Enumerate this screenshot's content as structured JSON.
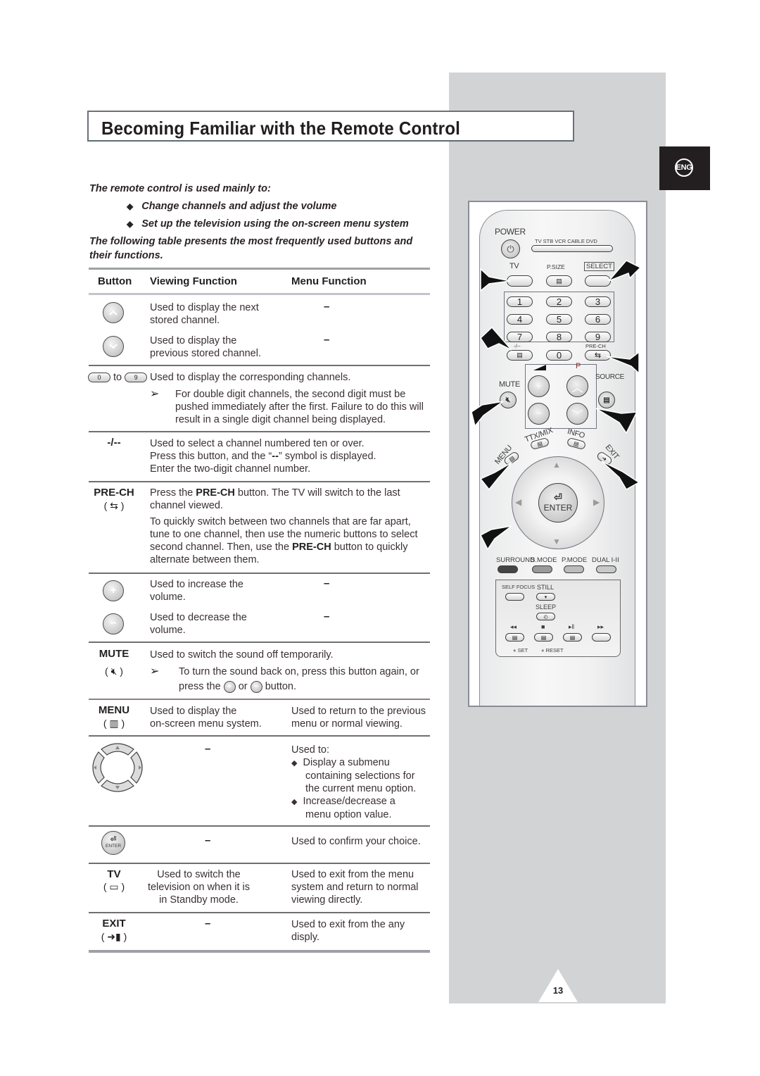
{
  "page": {
    "title": "Becoming Familiar with the Remote Control",
    "language_tab": "ENG",
    "page_number": "13"
  },
  "intro": {
    "lead": "The remote control is used mainly to:",
    "bullets": [
      "Change channels and adjust the volume",
      "Set up the television using the on-screen menu system"
    ],
    "table_intro_line1": "The following table presents the most frequently used buttons and",
    "table_intro_line2": "their functions."
  },
  "table": {
    "headers": {
      "button": "Button",
      "viewing": "Viewing Function",
      "menu": "Menu Function"
    },
    "dash": "–",
    "rows": {
      "ch_up": {
        "icon": "channel-up-button",
        "viewing_l1": "Used to display the next",
        "viewing_l2": "stored channel.",
        "menu": "–"
      },
      "ch_down": {
        "icon": "channel-down-button",
        "viewing_l1": "Used to display the",
        "viewing_l2": "previous stored channel.",
        "menu": "–"
      },
      "numeric": {
        "from_key": "0",
        "to_word": "to",
        "to_key": "9",
        "viewing": "Used to display the corresponding channels.",
        "note_l1": "For double digit channels, the second digit must be",
        "note_l2": "pushed immediately after the first. Failure to do this will",
        "note_l3": "result in a single digit channel being displayed."
      },
      "digit": {
        "label": "-/--",
        "l1": "Used to select a channel numbered ten or over.",
        "l2_pre": "Press this button, and the “",
        "l2_sym": "--",
        "l2_post": "” symbol is displayed.",
        "l3": "Enter the two-digit channel number."
      },
      "prech": {
        "label": "PRE-CH",
        "symbol": "( ⇆ )",
        "l1_pre": "Press the ",
        "l1_bold": "PRE-CH",
        "l1_post": " button. The TV will switch to the last",
        "l2": "channel viewed.",
        "p2_l1": "To quickly switch between two channels that are far apart,",
        "p2_l2": "tune to one channel, then use the numeric buttons to select",
        "p2_l3_pre": "second channel. Then, use the ",
        "p2_l3_bold": "PRE-CH",
        "p2_l3_post": " button to quickly",
        "p2_l4": "alternate between them."
      },
      "vol_up": {
        "icon": "volume-up-button",
        "viewing_l1": "Used to increase the",
        "viewing_l2": "volume.",
        "menu": "–"
      },
      "vol_down": {
        "icon": "volume-down-button",
        "viewing_l1": "Used to decrease the",
        "viewing_l2": "volume.",
        "menu": "–"
      },
      "mute": {
        "label": "MUTE",
        "symbol": "( 🔇︎ )",
        "viewing": "Used to switch the sound off temporarily.",
        "note_l1": "To turn the sound back on, press this button again, or",
        "note_l2_pre": "press the",
        "note_l2_or": "or",
        "note_l2_post": "button."
      },
      "menu": {
        "label": "MENU",
        "symbol": "( ▥ )",
        "viewing_l1": "Used to display the",
        "viewing_l2": "on-screen menu system.",
        "menu_l1": "Used to return to the previous",
        "menu_l2": "menu or normal viewing."
      },
      "arrows": {
        "viewing": "–",
        "menu_l1": "Used to:",
        "b1_l1": "Display a submenu",
        "b1_l2": "containing selections for",
        "b1_l3": "the current menu option.",
        "b2_l1": "Increase/decrease a",
        "b2_l2": "menu option value."
      },
      "enter": {
        "icon_text": "ENTER",
        "viewing": "–",
        "menu": "Used to confirm your choice."
      },
      "tv": {
        "label": "TV",
        "symbol": "( ▭ )",
        "viewing_l1": "Used to switch the",
        "viewing_l2": "television on when it is",
        "viewing_l3": "in Standby mode.",
        "menu_l1": "Used to exit from the menu",
        "menu_l2": "system and return to normal",
        "menu_l3": "viewing directly."
      },
      "exit": {
        "label": "EXIT",
        "symbol": "( ➜▮ )",
        "viewing": "–",
        "menu_l1": "Used to exit from the any",
        "menu_l2": "disply."
      }
    }
  },
  "remote": {
    "power": "POWER",
    "modes": "TV  STB  VCR  CABLE  DVD",
    "tv": "TV",
    "psize": "P.SIZE",
    "select": "SELECT",
    "digits": [
      "1",
      "2",
      "3",
      "4",
      "5",
      "6",
      "7",
      "8",
      "9",
      "0"
    ],
    "digit_label": "-/--",
    "prech_label": "PRE-CH",
    "p_label": "P",
    "mute": "MUTE",
    "source": "SOURCE",
    "ttx": "TTX/MIX",
    "info": "INFO",
    "menu": "MENU",
    "exit": "EXIT",
    "enter": "ENTER",
    "surround": "SURROUND",
    "smode": "S.MODE",
    "pmode": "P.MODE",
    "dual": "DUAL I-II",
    "selffocus": "SELF FOCUS",
    "still": "STILL",
    "sleep": "SLEEP",
    "rew": "◂◂",
    "stop": "■",
    "play": "▸ǁ",
    "ff": "▸▸",
    "set": "SET",
    "reset": "RESET"
  }
}
